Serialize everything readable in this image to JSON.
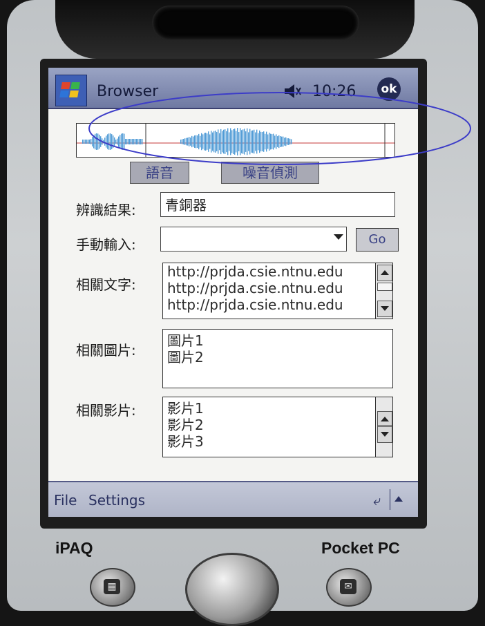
{
  "titlebar": {
    "app_title": "Browser",
    "time": "10:26",
    "ok_label": "ok",
    "start_icon": "windows-flag-icon",
    "volume_icon": "speaker-muted-icon"
  },
  "controls": {
    "speech_button": "語音",
    "noise_button": "噪音偵測"
  },
  "recognition": {
    "label": "辨識結果:",
    "value": "青銅器"
  },
  "manual_input": {
    "label": "手動輸入:",
    "value": "",
    "go_label": "Go"
  },
  "related_text": {
    "label": "相關文字:",
    "items": [
      "http://prjda.csie.ntnu.edu",
      "http://prjda.csie.ntnu.edu",
      "http://prjda.csie.ntnu.edu"
    ]
  },
  "related_images": {
    "label": "相關圖片:",
    "items": [
      "圖片1",
      "圖片2"
    ]
  },
  "related_videos": {
    "label": "相關影片:",
    "items": [
      "影片1",
      "影片2",
      "影片3"
    ]
  },
  "menubar": {
    "file": "File",
    "settings": "Settings",
    "sip_icon": "keyboard-sip-icon"
  },
  "device": {
    "brand_left": "iPAQ",
    "brand_right": "Pocket PC"
  },
  "colors": {
    "titlebar": "#6f79a2",
    "waveform": "#4f9bd6",
    "waveform_line": "#c43a3a",
    "annotation_ellipse": "#3c3cc8"
  }
}
